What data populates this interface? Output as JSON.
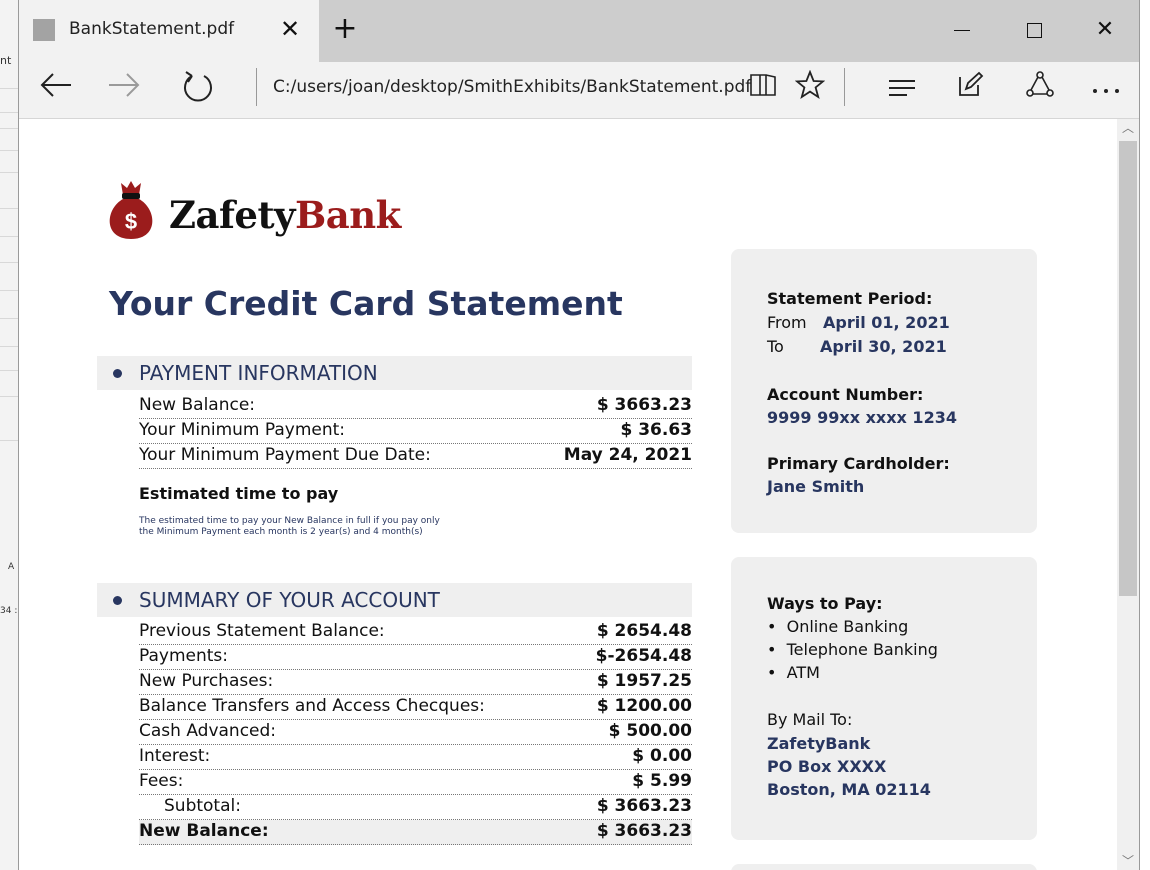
{
  "browser": {
    "tab_title": "BankStatement.pdf",
    "close_glyph": "✕",
    "new_tab_glyph": "+",
    "address": "C:/users/joan/desktop/SmithExhibits/BankStatement.pdf",
    "window_close_glyph": "✕"
  },
  "background_app": {
    "fragments": [
      "nt",
      "A",
      "34 :"
    ]
  },
  "bank": {
    "name_part1": "Zafety",
    "name_part2": "Bank",
    "logo_symbol": "$",
    "brand_color": "#9b1c1c"
  },
  "statement": {
    "title": "Your Credit Card Statement",
    "payment_section": {
      "heading": "PAYMENT INFORMATION",
      "rows": [
        {
          "label": "New Balance:",
          "value": "$ 3663.23"
        },
        {
          "label": "Your Minimum Payment:",
          "value": "$ 36.63"
        },
        {
          "label": "Your Minimum Payment Due Date:",
          "value": "May 24, 2021"
        }
      ],
      "estimate_title": "Estimated time to pay",
      "estimate_text_1": "The estimated time to pay your New Balance in full if you pay only",
      "estimate_text_2": "the Minimum Payment each month is 2 year(s) and 4 month(s)"
    },
    "summary_section": {
      "heading": "SUMMARY OF YOUR ACCOUNT",
      "rows": [
        {
          "label": "Previous Statement Balance:",
          "value": "$ 2654.48"
        },
        {
          "label": "Payments:",
          "value": "$-2654.48"
        },
        {
          "label": "New Purchases:",
          "value": "$ 1957.25"
        },
        {
          "label": "Balance Transfers and Access Checques:",
          "value": "$ 1200.00"
        },
        {
          "label": "Cash Advanced:",
          "value": "$ 500.00"
        },
        {
          "label": "Interest:",
          "value": "$ 0.00"
        },
        {
          "label": "Fees:",
          "value": "$ 5.99"
        },
        {
          "label": "Subtotal:",
          "value": "$ 3663.23"
        },
        {
          "label": "New Balance:",
          "value": "$ 3663.23"
        }
      ]
    },
    "period": {
      "heading": "Statement Period:",
      "from_label": "From",
      "from_date": "April 01, 2021",
      "to_label": "To",
      "to_date": "April 30, 2021"
    },
    "account": {
      "heading": "Account Number:",
      "number": "9999 99xx xxxx 1234"
    },
    "cardholder": {
      "heading": "Primary Cardholder:",
      "name": "Jane Smith"
    },
    "ways_to_pay": {
      "heading": "Ways to Pay:",
      "items": [
        "Online Banking",
        "Telephone Banking",
        "ATM"
      ],
      "mail_heading": "By Mail To:",
      "mail_lines": [
        "ZafetyBank",
        "PO Box XXXX",
        "Boston, MA 02114"
      ]
    }
  },
  "colors": {
    "accent": "#283660",
    "panel": "#efefef"
  }
}
